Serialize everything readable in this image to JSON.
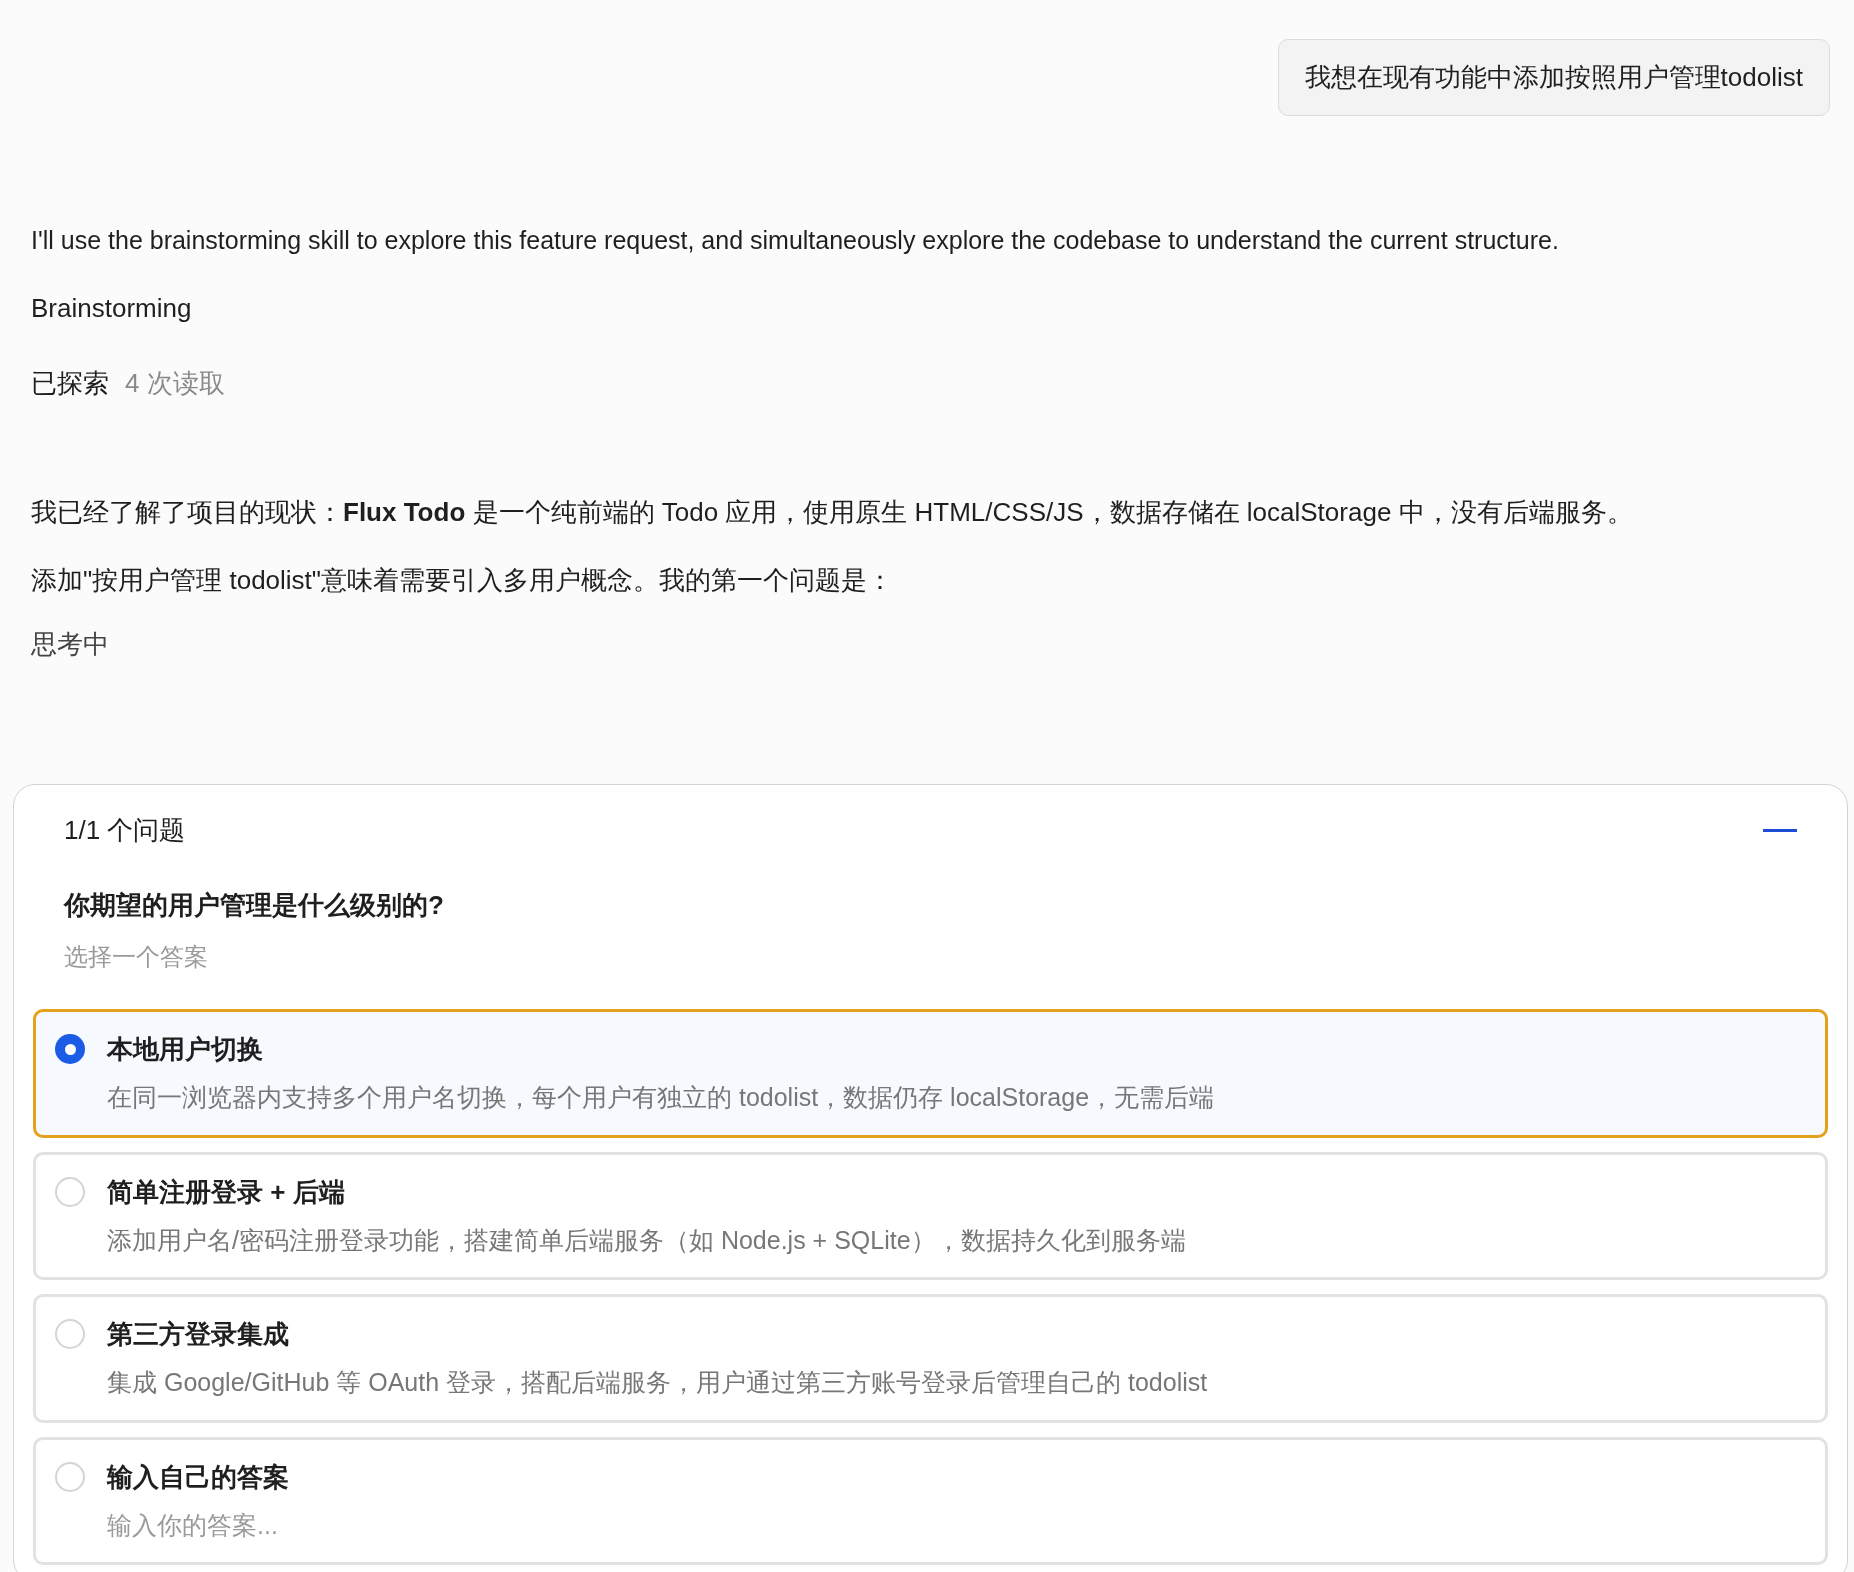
{
  "user_message": "我想在现有功能中添加按照用户管理todolist",
  "assistant": {
    "intro": "I'll use the brainstorming skill to explore this feature request, and simultaneously explore the codebase to understand the current structure.",
    "skill": "Brainstorming",
    "explored": {
      "label": "已探索",
      "detail": "4 次读取"
    },
    "paragraphs": [
      "我已经了解了项目的现状：**Flux Todo** 是一个纯前端的 Todo 应用，使用原生 HTML/CSS/JS，数据存储在 localStorage 中，没有后端服务。",
      "添加\"按用户管理 todolist\"意味着需要引入多用户概念。我的第一个问题是："
    ],
    "status": "思考中"
  },
  "question_panel": {
    "counter": "1/1 个问题",
    "question": "你期望的用户管理是什么级别的?",
    "hint": "选择一个答案",
    "options": [
      {
        "kind": "choice",
        "title": "本地用户切换",
        "description": "在同一浏览器内支持多个用户名切换，每个用户有独立的 todolist，数据仍存 localStorage，无需后端",
        "selected": true
      },
      {
        "kind": "choice",
        "title": "简单注册登录 + 后端",
        "description": "添加用户名/密码注册登录功能，搭建简单后端服务（如 Node.js + SQLite），数据持久化到服务端",
        "selected": false
      },
      {
        "kind": "choice",
        "title": "第三方登录集成",
        "description": "集成 Google/GitHub 等 OAuth 登录，搭配后端服务，用户通过第三方账号登录后管理自己的 todolist",
        "selected": false
      },
      {
        "kind": "custom",
        "title": "输入自己的答案",
        "placeholder": "输入你的答案...",
        "selected": false
      }
    ]
  }
}
